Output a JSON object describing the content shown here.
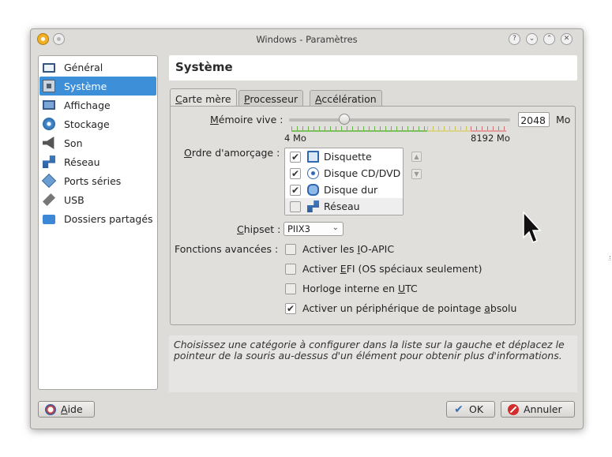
{
  "window": {
    "title": "Windows - Paramètres",
    "title_buttons": [
      "?",
      "⌄",
      "⌃",
      "✕"
    ]
  },
  "sidebar": {
    "items": [
      {
        "label": "Général",
        "icon": "monitor-icon",
        "active": false
      },
      {
        "label": "Système",
        "icon": "chip-icon",
        "active": true
      },
      {
        "label": "Affichage",
        "icon": "display-icon",
        "active": false
      },
      {
        "label": "Stockage",
        "icon": "disk-icon",
        "active": false
      },
      {
        "label": "Son",
        "icon": "speaker-icon",
        "active": false
      },
      {
        "label": "Réseau",
        "icon": "network-icon",
        "active": false
      },
      {
        "label": "Ports séries",
        "icon": "serial-ports-icon",
        "active": false
      },
      {
        "label": "USB",
        "icon": "usb-icon",
        "active": false
      },
      {
        "label": "Dossiers partagés",
        "icon": "folder-icon",
        "active": false
      }
    ]
  },
  "header": {
    "title": "Système"
  },
  "tabs": {
    "motherboard": {
      "label_u": "C",
      "label_rest": "arte mère",
      "active": true
    },
    "processor": {
      "label_u": "P",
      "label_rest": "rocesseur",
      "active": false
    },
    "acceleration": {
      "label_u": "A",
      "label_rest": "ccélération",
      "active": false
    }
  },
  "memory": {
    "label_u": "M",
    "label_rest": "émoire vive :",
    "value": "2048",
    "unit": "Mo",
    "min_label": "4 Mo",
    "max_label": "8192 Mo",
    "slider_fraction": 0.25
  },
  "boot_order": {
    "label_u": "O",
    "label_rest": "rdre d'amorçage :",
    "items": [
      {
        "label": "Disquette",
        "checked": true,
        "icon": "floppy-icon"
      },
      {
        "label": "Disque CD/DVD",
        "checked": true,
        "icon": "cd-icon"
      },
      {
        "label": "Disque dur",
        "checked": true,
        "icon": "hard-disk-icon"
      },
      {
        "label": "Réseau",
        "checked": false,
        "icon": "network-icon"
      }
    ]
  },
  "chipset": {
    "label_u": "C",
    "label_rest": "hipset :",
    "value": "PIIX3"
  },
  "advanced": {
    "label": "Fonctions avancées :",
    "options": [
      {
        "pre": "Activer les ",
        "u": "I",
        "post": "O-APIC",
        "checked": false
      },
      {
        "pre": "Activer ",
        "u": "E",
        "post": "FI (OS spéciaux seulement)",
        "checked": false
      },
      {
        "pre": "Horloge interne en ",
        "u": "U",
        "post": "TC",
        "checked": false
      },
      {
        "pre": "Activer un périphérique de pointage ",
        "u": "a",
        "post": "bsolu",
        "checked": true
      }
    ]
  },
  "description": "Choisissez une catégorie à configurer dans la liste sur la gauche et déplacez le pointeur de la souris au-dessus d'un élément pour obtenir plus d'informations.",
  "buttons": {
    "help": {
      "u": "A",
      "rest": "ide"
    },
    "ok": "OK",
    "cancel": "Annuler"
  }
}
